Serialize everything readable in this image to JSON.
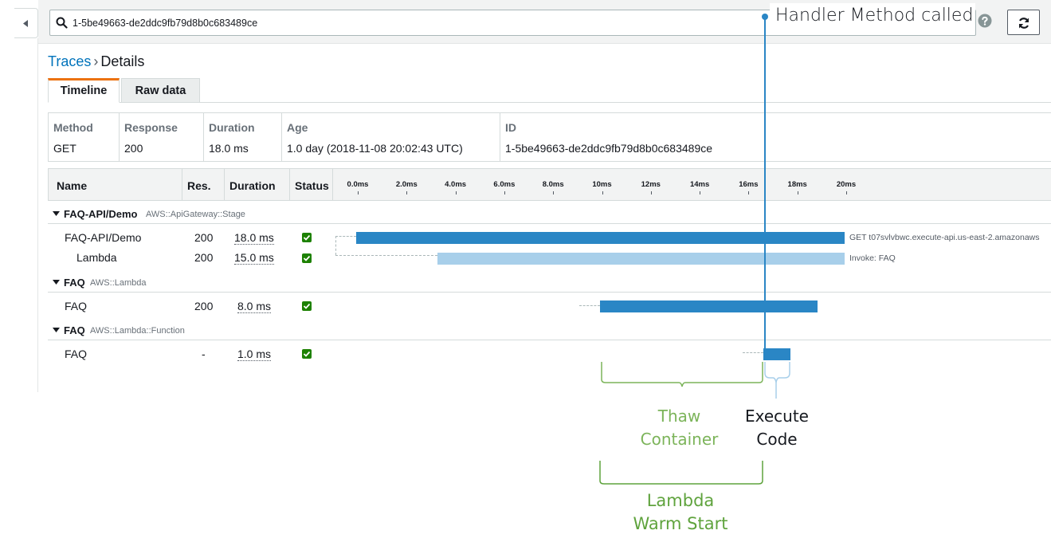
{
  "search": {
    "value": "1-5be49663-de2ddc9fb79d8b0c683489ce"
  },
  "breadcrumb": {
    "link": "Traces",
    "separator": "›",
    "current": "Details"
  },
  "tabs": [
    {
      "label": "Timeline",
      "active": true
    },
    {
      "label": "Raw data",
      "active": false
    }
  ],
  "summary": {
    "method": {
      "label": "Method",
      "value": "GET"
    },
    "response": {
      "label": "Response",
      "value": "200"
    },
    "duration": {
      "label": "Duration",
      "value": "18.0 ms"
    },
    "age": {
      "label": "Age",
      "value": "1.0 day (2018-11-08 20:02:43 UTC)"
    },
    "id": {
      "label": "ID",
      "value": "1-5be49663-de2ddc9fb79d8b0c683489ce"
    }
  },
  "grid": {
    "headers": {
      "name": "Name",
      "res": "Res.",
      "duration": "Duration",
      "status": "Status"
    },
    "ticks": [
      "0.0ms",
      "2.0ms",
      "4.0ms",
      "6.0ms",
      "8.0ms",
      "10ms",
      "12ms",
      "14ms",
      "16ms",
      "18ms",
      "20ms"
    ]
  },
  "groups": [
    {
      "name": "FAQ-API/Demo",
      "type": "AWS::ApiGateway::Stage",
      "rows": [
        {
          "name": "FAQ-API/Demo",
          "res": "200",
          "duration": "18.0 ms",
          "status": "ok",
          "bar_label": "GET t07svlvbwc.execute-api.us-east-2.amazonaws"
        },
        {
          "name": "Lambda",
          "res": "200",
          "duration": "15.0 ms",
          "status": "ok",
          "bar_label": "Invoke: FAQ"
        }
      ]
    },
    {
      "name": "FAQ",
      "type": "AWS::Lambda",
      "rows": [
        {
          "name": "FAQ",
          "res": "200",
          "duration": "8.0 ms",
          "status": "ok"
        }
      ]
    },
    {
      "name": "FAQ",
      "type": "AWS::Lambda::Function",
      "rows": [
        {
          "name": "FAQ",
          "res": "-",
          "duration": "1.0 ms",
          "status": "ok"
        }
      ]
    }
  ],
  "annotations": {
    "handler": "Handler Method called",
    "thaw": [
      "Thaw",
      "Container"
    ],
    "execute": [
      "Execute",
      "Code"
    ],
    "warm": [
      "Lambda",
      "Warm Start"
    ]
  },
  "colors": {
    "link": "#0073bb",
    "tab_accent": "#ec7211",
    "bar_dark": "#2a86c5",
    "bar_light": "#a8cfea",
    "status_ok": "#1d8102",
    "thaw_green": "#7cb45a",
    "warm_green": "#5fa33d"
  },
  "icons": [
    "collapse-arrow-icon",
    "search-icon",
    "help-icon",
    "refresh-icon",
    "caret-down-icon",
    "check-icon"
  ]
}
